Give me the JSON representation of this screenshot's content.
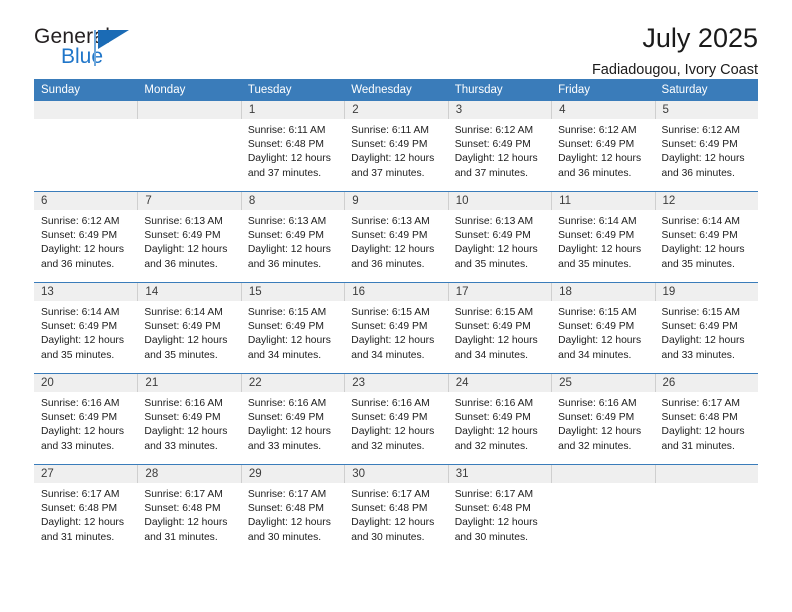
{
  "logo": {
    "word1": "General",
    "word2": "Blue",
    "triangle_color": "#1b6bb5",
    "blue_color": "#2076c9"
  },
  "header": {
    "title": "July 2025",
    "location": "Fadiadougou, Ivory Coast"
  },
  "theme": {
    "header_blue": "#3a7cba",
    "daynum_band": "#efefef",
    "row_divider": "#3a7cba"
  },
  "weekday_headers": [
    "Sunday",
    "Monday",
    "Tuesday",
    "Wednesday",
    "Thursday",
    "Friday",
    "Saturday"
  ],
  "weeks": [
    [
      {
        "day": "",
        "empty": true
      },
      {
        "day": "",
        "empty": true
      },
      {
        "day": "1",
        "sunrise": "Sunrise: 6:11 AM",
        "sunset": "Sunset: 6:48 PM",
        "daylight1": "Daylight: 12 hours",
        "daylight2": "and 37 minutes."
      },
      {
        "day": "2",
        "sunrise": "Sunrise: 6:11 AM",
        "sunset": "Sunset: 6:49 PM",
        "daylight1": "Daylight: 12 hours",
        "daylight2": "and 37 minutes."
      },
      {
        "day": "3",
        "sunrise": "Sunrise: 6:12 AM",
        "sunset": "Sunset: 6:49 PM",
        "daylight1": "Daylight: 12 hours",
        "daylight2": "and 37 minutes."
      },
      {
        "day": "4",
        "sunrise": "Sunrise: 6:12 AM",
        "sunset": "Sunset: 6:49 PM",
        "daylight1": "Daylight: 12 hours",
        "daylight2": "and 36 minutes."
      },
      {
        "day": "5",
        "sunrise": "Sunrise: 6:12 AM",
        "sunset": "Sunset: 6:49 PM",
        "daylight1": "Daylight: 12 hours",
        "daylight2": "and 36 minutes."
      }
    ],
    [
      {
        "day": "6",
        "sunrise": "Sunrise: 6:12 AM",
        "sunset": "Sunset: 6:49 PM",
        "daylight1": "Daylight: 12 hours",
        "daylight2": "and 36 minutes."
      },
      {
        "day": "7",
        "sunrise": "Sunrise: 6:13 AM",
        "sunset": "Sunset: 6:49 PM",
        "daylight1": "Daylight: 12 hours",
        "daylight2": "and 36 minutes."
      },
      {
        "day": "8",
        "sunrise": "Sunrise: 6:13 AM",
        "sunset": "Sunset: 6:49 PM",
        "daylight1": "Daylight: 12 hours",
        "daylight2": "and 36 minutes."
      },
      {
        "day": "9",
        "sunrise": "Sunrise: 6:13 AM",
        "sunset": "Sunset: 6:49 PM",
        "daylight1": "Daylight: 12 hours",
        "daylight2": "and 36 minutes."
      },
      {
        "day": "10",
        "sunrise": "Sunrise: 6:13 AM",
        "sunset": "Sunset: 6:49 PM",
        "daylight1": "Daylight: 12 hours",
        "daylight2": "and 35 minutes."
      },
      {
        "day": "11",
        "sunrise": "Sunrise: 6:14 AM",
        "sunset": "Sunset: 6:49 PM",
        "daylight1": "Daylight: 12 hours",
        "daylight2": "and 35 minutes."
      },
      {
        "day": "12",
        "sunrise": "Sunrise: 6:14 AM",
        "sunset": "Sunset: 6:49 PM",
        "daylight1": "Daylight: 12 hours",
        "daylight2": "and 35 minutes."
      }
    ],
    [
      {
        "day": "13",
        "sunrise": "Sunrise: 6:14 AM",
        "sunset": "Sunset: 6:49 PM",
        "daylight1": "Daylight: 12 hours",
        "daylight2": "and 35 minutes."
      },
      {
        "day": "14",
        "sunrise": "Sunrise: 6:14 AM",
        "sunset": "Sunset: 6:49 PM",
        "daylight1": "Daylight: 12 hours",
        "daylight2": "and 35 minutes."
      },
      {
        "day": "15",
        "sunrise": "Sunrise: 6:15 AM",
        "sunset": "Sunset: 6:49 PM",
        "daylight1": "Daylight: 12 hours",
        "daylight2": "and 34 minutes."
      },
      {
        "day": "16",
        "sunrise": "Sunrise: 6:15 AM",
        "sunset": "Sunset: 6:49 PM",
        "daylight1": "Daylight: 12 hours",
        "daylight2": "and 34 minutes."
      },
      {
        "day": "17",
        "sunrise": "Sunrise: 6:15 AM",
        "sunset": "Sunset: 6:49 PM",
        "daylight1": "Daylight: 12 hours",
        "daylight2": "and 34 minutes."
      },
      {
        "day": "18",
        "sunrise": "Sunrise: 6:15 AM",
        "sunset": "Sunset: 6:49 PM",
        "daylight1": "Daylight: 12 hours",
        "daylight2": "and 34 minutes."
      },
      {
        "day": "19",
        "sunrise": "Sunrise: 6:15 AM",
        "sunset": "Sunset: 6:49 PM",
        "daylight1": "Daylight: 12 hours",
        "daylight2": "and 33 minutes."
      }
    ],
    [
      {
        "day": "20",
        "sunrise": "Sunrise: 6:16 AM",
        "sunset": "Sunset: 6:49 PM",
        "daylight1": "Daylight: 12 hours",
        "daylight2": "and 33 minutes."
      },
      {
        "day": "21",
        "sunrise": "Sunrise: 6:16 AM",
        "sunset": "Sunset: 6:49 PM",
        "daylight1": "Daylight: 12 hours",
        "daylight2": "and 33 minutes."
      },
      {
        "day": "22",
        "sunrise": "Sunrise: 6:16 AM",
        "sunset": "Sunset: 6:49 PM",
        "daylight1": "Daylight: 12 hours",
        "daylight2": "and 33 minutes."
      },
      {
        "day": "23",
        "sunrise": "Sunrise: 6:16 AM",
        "sunset": "Sunset: 6:49 PM",
        "daylight1": "Daylight: 12 hours",
        "daylight2": "and 32 minutes."
      },
      {
        "day": "24",
        "sunrise": "Sunrise: 6:16 AM",
        "sunset": "Sunset: 6:49 PM",
        "daylight1": "Daylight: 12 hours",
        "daylight2": "and 32 minutes."
      },
      {
        "day": "25",
        "sunrise": "Sunrise: 6:16 AM",
        "sunset": "Sunset: 6:49 PM",
        "daylight1": "Daylight: 12 hours",
        "daylight2": "and 32 minutes."
      },
      {
        "day": "26",
        "sunrise": "Sunrise: 6:17 AM",
        "sunset": "Sunset: 6:48 PM",
        "daylight1": "Daylight: 12 hours",
        "daylight2": "and 31 minutes."
      }
    ],
    [
      {
        "day": "27",
        "sunrise": "Sunrise: 6:17 AM",
        "sunset": "Sunset: 6:48 PM",
        "daylight1": "Daylight: 12 hours",
        "daylight2": "and 31 minutes."
      },
      {
        "day": "28",
        "sunrise": "Sunrise: 6:17 AM",
        "sunset": "Sunset: 6:48 PM",
        "daylight1": "Daylight: 12 hours",
        "daylight2": "and 31 minutes."
      },
      {
        "day": "29",
        "sunrise": "Sunrise: 6:17 AM",
        "sunset": "Sunset: 6:48 PM",
        "daylight1": "Daylight: 12 hours",
        "daylight2": "and 30 minutes."
      },
      {
        "day": "30",
        "sunrise": "Sunrise: 6:17 AM",
        "sunset": "Sunset: 6:48 PM",
        "daylight1": "Daylight: 12 hours",
        "daylight2": "and 30 minutes."
      },
      {
        "day": "31",
        "sunrise": "Sunrise: 6:17 AM",
        "sunset": "Sunset: 6:48 PM",
        "daylight1": "Daylight: 12 hours",
        "daylight2": "and 30 minutes."
      },
      {
        "day": "",
        "empty": true
      },
      {
        "day": "",
        "empty": true
      }
    ]
  ]
}
